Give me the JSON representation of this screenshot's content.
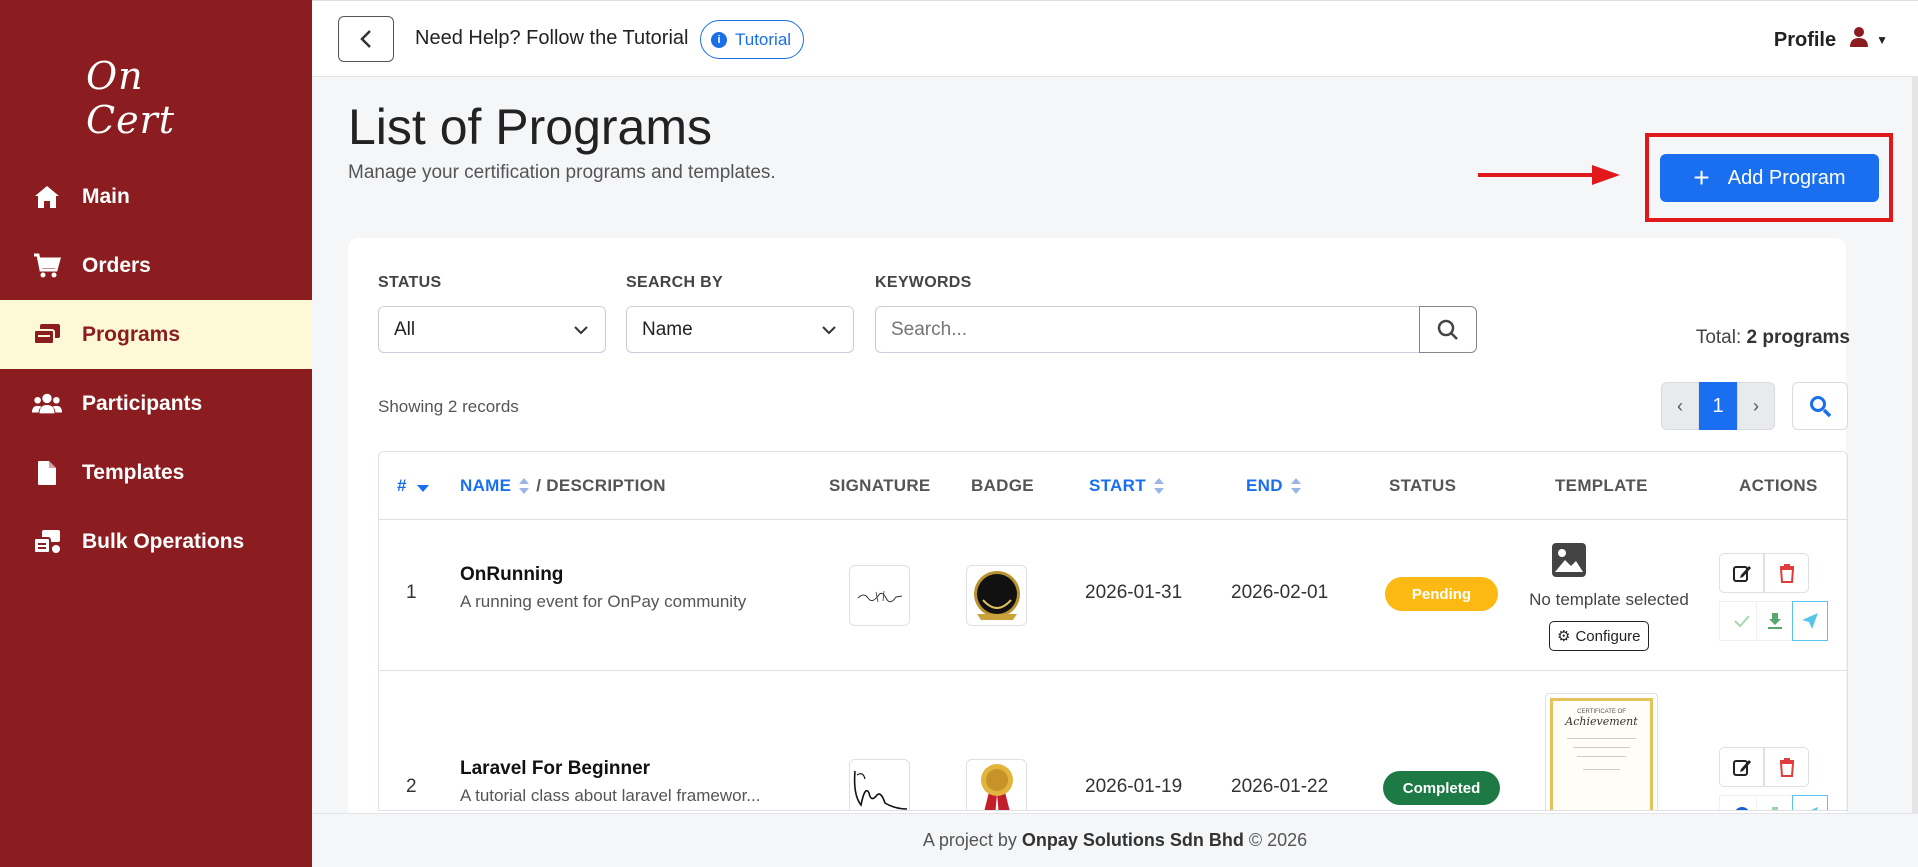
{
  "app": {
    "logo_text": "On Cert"
  },
  "sidebar": {
    "items": [
      {
        "label": "Main",
        "icon": "home-icon",
        "active": false
      },
      {
        "label": "Orders",
        "icon": "cart-icon",
        "active": false
      },
      {
        "label": "Programs",
        "icon": "programs-icon",
        "active": true
      },
      {
        "label": "Participants",
        "icon": "users-icon",
        "active": false
      },
      {
        "label": "Templates",
        "icon": "file-icon",
        "active": false
      },
      {
        "label": "Bulk Operations",
        "icon": "bulk-icon",
        "active": false
      }
    ]
  },
  "topbar": {
    "help_text": "Need Help? Follow the Tutorial",
    "tutorial_label": "Tutorial",
    "profile_label": "Profile"
  },
  "header": {
    "title": "List of Programs",
    "subtitle": "Manage your certification programs and templates.",
    "add_label": "Add Program"
  },
  "filters": {
    "status_label": "STATUS",
    "status_value": "All",
    "searchby_label": "SEARCH BY",
    "searchby_value": "Name",
    "keywords_label": "KEYWORDS",
    "keywords_placeholder": "Search..."
  },
  "summary": {
    "total_prefix": "Total:",
    "total_value": "2 programs",
    "showing": "Showing 2 records"
  },
  "pagination": {
    "prev": "‹",
    "current": "1",
    "next": "›"
  },
  "table": {
    "headers": {
      "num": "#",
      "name": "NAME",
      "desc": "/ DESCRIPTION",
      "signature": "SIGNATURE",
      "badge": "BADGE",
      "start": "START",
      "end": "END",
      "status": "STATUS",
      "template": "TEMPLATE",
      "actions": "ACTIONS"
    },
    "rows": [
      {
        "num": "1",
        "name": "OnRunning",
        "desc": "A running event for OnPay community",
        "start": "2026-01-31",
        "end": "2026-02-01",
        "status": "Pending",
        "template_text": "No template selected",
        "configure_label": "Configure"
      },
      {
        "num": "2",
        "name": "Laravel For Beginner",
        "desc": "A tutorial class about laravel framewor...",
        "start": "2026-01-19",
        "end": "2026-01-22",
        "status": "Completed",
        "template_title": "Achievement",
        "template_sub": "CERTIFICATE OF"
      }
    ]
  },
  "footer": {
    "prefix": "A project by",
    "company": "Onpay Solutions Sdn Bhd",
    "suffix": "© 2026"
  },
  "colors": {
    "sidebar_bg": "#8b1c1f",
    "active_bg": "#fdf8d6",
    "primary": "#1a6ff0",
    "pending": "#fdb913",
    "completed": "#1d7a45",
    "highlight": "#e0181b"
  }
}
